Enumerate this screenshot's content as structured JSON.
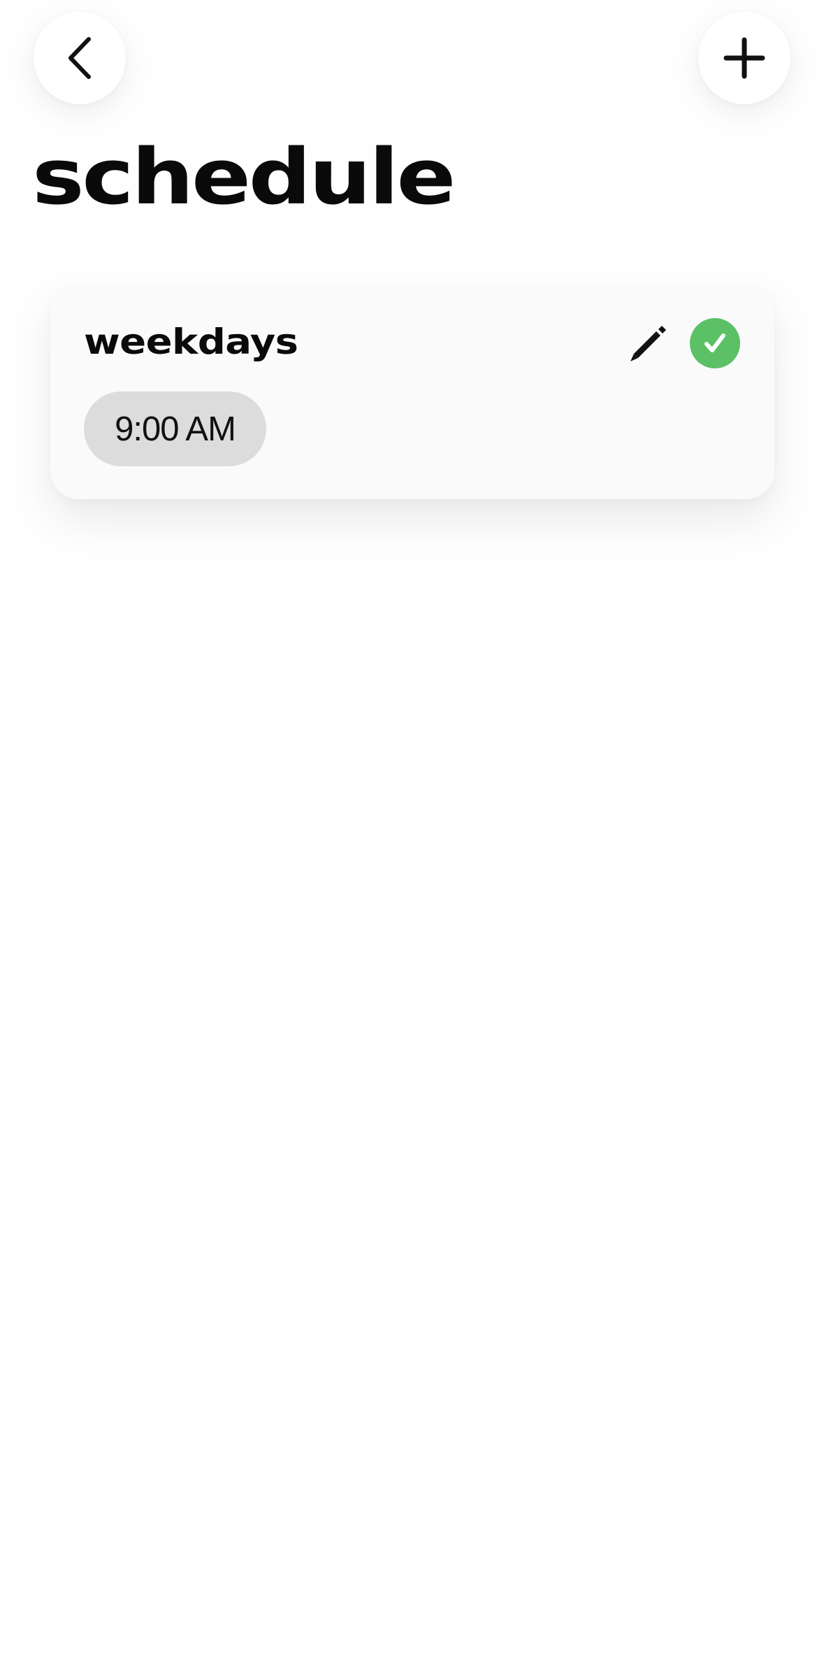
{
  "header": {
    "back_icon": "chevron-left-icon",
    "add_icon": "plus-icon",
    "title": "schedule"
  },
  "schedules": [
    {
      "name": "weekdays",
      "edit_icon": "pencil-icon",
      "status_icon": "check-circle-icon",
      "status_color": "#5cc067",
      "times": [
        "9:00 AM"
      ]
    }
  ],
  "colors": {
    "background": "#fefefe",
    "card": "#fafafa",
    "time_chip": "#dcdcdc",
    "text": "#0d0d0d"
  }
}
